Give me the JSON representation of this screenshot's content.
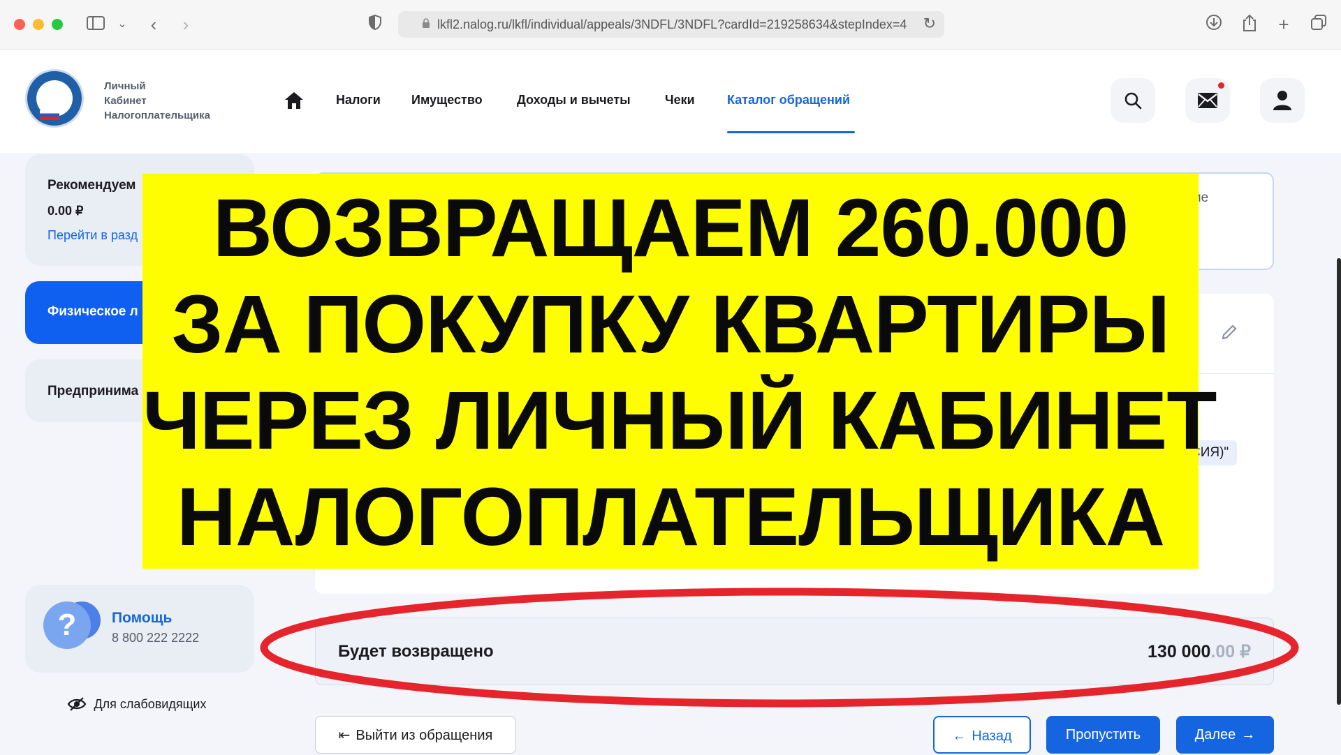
{
  "browser": {
    "url": "lkfl2.nalog.ru/lkfl/individual/appeals/3NDFL/3NDFL?cardId=219258634&stepIndex=4"
  },
  "header": {
    "brand_line1": "Личный",
    "brand_line2": "Кабинет",
    "brand_line3": "Налогоплательщика",
    "nav": [
      "Налоги",
      "Имущество",
      "Доходы и вычеты",
      "Чеки",
      "Каталог обращений"
    ]
  },
  "sidebar": {
    "recommended_title": "Рекомендуем",
    "recommended_amount": "0.00 ₽",
    "recommended_link": "Перейти в разд",
    "individual_label": "Физическое л",
    "entrepreneur_label": "Предпринима",
    "help_title": "Помощь",
    "help_phone": "8 800 222 2222",
    "accessibility": "Для слабовидящих"
  },
  "main": {
    "partial_right_1": "ие",
    "partial_right_2": "СИЯ)\"",
    "result_label": "Будет возвращено",
    "result_amount_main": "130 000",
    "result_amount_cents": ".00 ₽"
  },
  "buttons": {
    "exit": "Выйти из обращения",
    "back": "Назад",
    "skip": "Пропустить",
    "next": "Далее"
  },
  "banner": {
    "line1": "ВОЗВРАЩАЕМ 260.000",
    "line2": "ЗА ПОКУПКУ КВАРТИРЫ",
    "line3": "ЧЕРЕЗ ЛИЧНЫЙ КАБИНЕТ",
    "line4": "НАЛОГОПЛАТЕЛЬЩИКА"
  },
  "colors": {
    "accent": "#1565e0",
    "banner": "#fefe00",
    "highlight": "#e5242b"
  }
}
